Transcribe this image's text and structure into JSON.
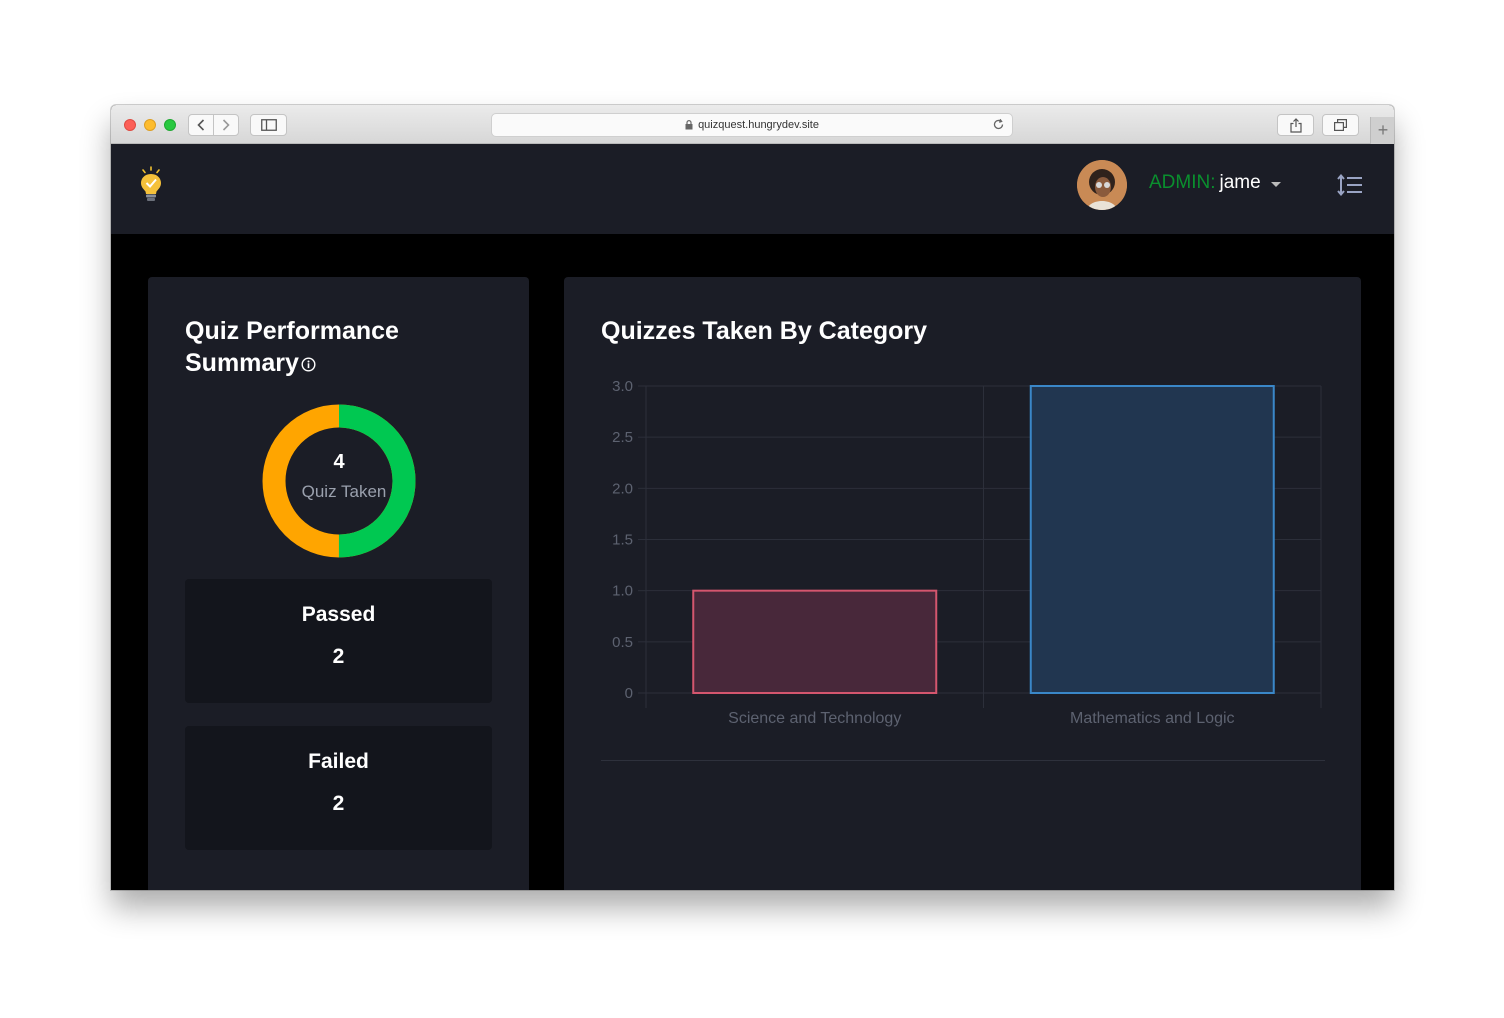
{
  "browser": {
    "url": "quizquest.hungrydev.site"
  },
  "header": {
    "user_role": "ADMIN:",
    "user_name": "jame"
  },
  "summary": {
    "title": "Quiz Performance Summary",
    "donut_count": "4",
    "donut_label": "Quiz Taken",
    "passed_label": "Passed",
    "passed_value": "2",
    "failed_label": "Failed",
    "failed_value": "2",
    "colors": {
      "passed": "#00c851",
      "failed": "#ffa500"
    }
  },
  "category_chart": {
    "title": "Quizzes Taken By Category"
  },
  "chart_data": {
    "type": "bar",
    "title": "Quizzes Taken By Category",
    "categories": [
      "Science and Technology",
      "Mathematics and Logic"
    ],
    "values": [
      1,
      3
    ],
    "ylim": [
      0,
      3
    ],
    "yticks": [
      "3.0",
      "2.5",
      "2.0",
      "1.5",
      "1.0",
      "0.5",
      "0"
    ],
    "grid": true,
    "colors": [
      {
        "fill": "#48283a",
        "stroke": "#d4566e"
      },
      {
        "fill": "#213650",
        "stroke": "#3a87c8"
      }
    ]
  }
}
